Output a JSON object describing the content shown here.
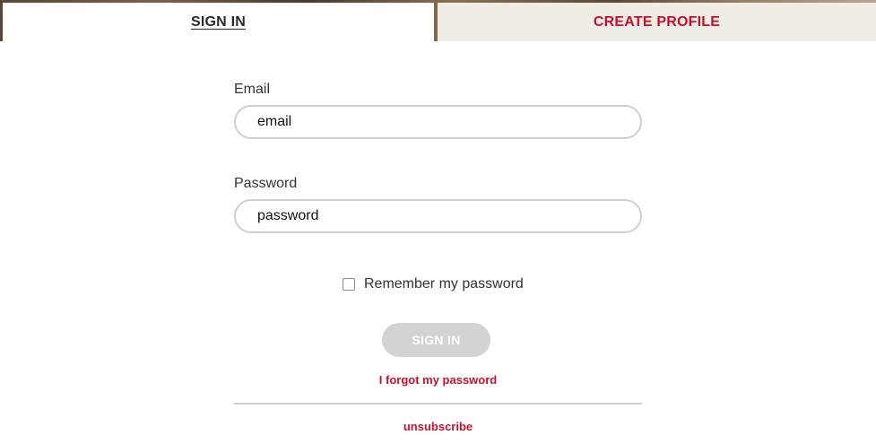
{
  "tabs": {
    "sign_in": "SIGN IN",
    "create_profile": "CREATE PROFILE"
  },
  "form": {
    "email_label": "Email",
    "email_placeholder": "email",
    "password_label": "Password",
    "password_placeholder": "password",
    "remember_label": "Remember my password",
    "remember_checked": false,
    "sign_in_button": "SIGN IN",
    "forgot_link": "I forgot my password",
    "unsubscribe_link": "unsubscribe"
  },
  "colors": {
    "accent_red": "#c8102e",
    "active_tab_bg": "#ffffff",
    "inactive_tab_bg": "#efede6",
    "disabled_button_bg": "#d3d3d3",
    "input_border": "#cfcfcf"
  },
  "icons": {
    "checkbox": "checkbox-icon"
  }
}
